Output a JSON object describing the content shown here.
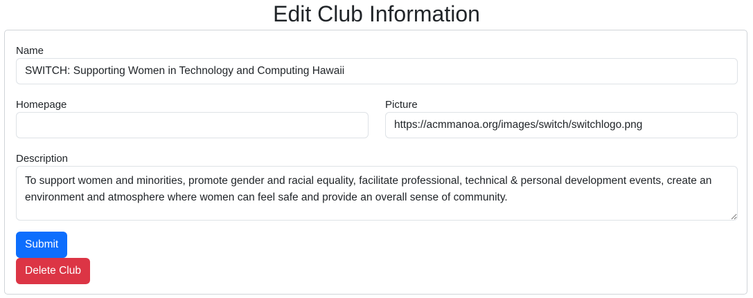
{
  "page": {
    "title": "Edit Club Information"
  },
  "form": {
    "name": {
      "label": "Name",
      "value": "SWITCH: Supporting Women in Technology and Computing Hawaii"
    },
    "homepage": {
      "label": "Homepage",
      "value": ""
    },
    "picture": {
      "label": "Picture",
      "value": "https://acmmanoa.org/images/switch/switchlogo.png"
    },
    "description": {
      "label": "Description",
      "value": "To support women and minorities, promote gender and racial equality, facilitate professional, technical & personal development events, create an environment and atmosphere where women can feel safe and provide an overall sense of community."
    },
    "submit_label": "Submit",
    "delete_label": "Delete Club"
  },
  "colors": {
    "primary": "#0d6efd",
    "danger": "#dc3545",
    "border": "#dee2e6",
    "text": "#212529"
  }
}
